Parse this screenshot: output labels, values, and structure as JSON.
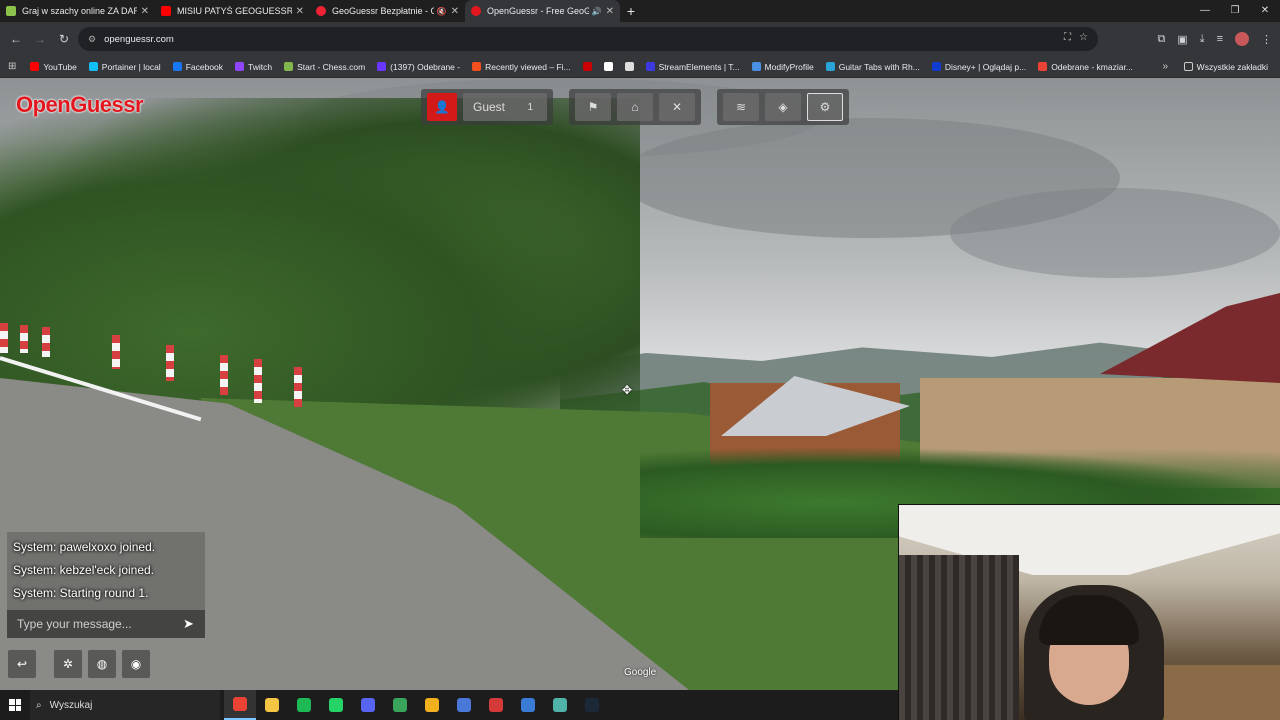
{
  "browser": {
    "tabs": [
      {
        "title": "Graj w szachy online ZA DARMO",
        "favicon_color": "#8bc34a",
        "active": false
      },
      {
        "title": "MISIU PATYŚ GEOGUESSR - You",
        "favicon_color": "#ff0000",
        "active": false
      },
      {
        "title": "GeoGuessr Bezpłatnie - Ge",
        "favicon_color": "#e23",
        "active": false
      },
      {
        "title": "OpenGuessr - Free GeoGue",
        "favicon_color": "#e4171f",
        "active": true
      }
    ],
    "new_tab_icon": "plus-icon",
    "url": "openguessr.com",
    "bookmarks": [
      {
        "label": "YouTube",
        "color": "#ff0000"
      },
      {
        "label": "Portainer | local",
        "color": "#13bef9"
      },
      {
        "label": "Facebook",
        "color": "#1877f2"
      },
      {
        "label": "Twitch",
        "color": "#9146ff"
      },
      {
        "label": "Start - Chess.com",
        "color": "#81b64c"
      },
      {
        "label": "(1397) Odebrane -",
        "color": "#6a35ff"
      },
      {
        "label": "Recently viewed – Fi...",
        "color": "#f24e1e"
      },
      {
        "label": "",
        "color": "#cc0000"
      },
      {
        "label": "",
        "color": "#ffffff"
      },
      {
        "label": "",
        "color": "#dddddd"
      },
      {
        "label": "StreamElements | T...",
        "color": "#3a3ae0"
      },
      {
        "label": "ModifyProfile",
        "color": "#4a90e2"
      },
      {
        "label": "Guitar Tabs with Rh...",
        "color": "#2aa4d8"
      },
      {
        "label": "Disney+ | Oglądaj p...",
        "color": "#113ccf"
      },
      {
        "label": "Odebrane - kmaziar...",
        "color": "#ea4335"
      }
    ],
    "all_bookmarks": "Wszystkie zakładki"
  },
  "game": {
    "brand": "OpenGuessr",
    "player_name": "Guest",
    "player_count": "1",
    "attribution": "Google",
    "chat": {
      "messages": [
        "System: pawelxoxo joined.",
        "System: kebzel'eck joined.",
        "System: Starting round 1."
      ],
      "placeholder": "Type your message..."
    }
  },
  "taskbar": {
    "search_label": "Wyszukaj",
    "apps": [
      {
        "name": "chrome",
        "color": "#ea4335",
        "active": true
      },
      {
        "name": "explorer",
        "color": "#f4c542",
        "active": false
      },
      {
        "name": "spotify",
        "color": "#1db954",
        "active": false
      },
      {
        "name": "whatsapp",
        "color": "#25d366",
        "active": false
      },
      {
        "name": "discord",
        "color": "#5865f2",
        "active": false
      },
      {
        "name": "app-green",
        "color": "#3aa65c",
        "active": false
      },
      {
        "name": "app-yellow",
        "color": "#f2b01e",
        "active": false
      },
      {
        "name": "app-blue",
        "color": "#4a78d9",
        "active": false
      },
      {
        "name": "app-red",
        "color": "#d43a3a",
        "active": false
      },
      {
        "name": "app-download",
        "color": "#3a7bd5",
        "active": false
      },
      {
        "name": "app-teal",
        "color": "#4fb3a9",
        "active": false
      },
      {
        "name": "steam",
        "color": "#1b2838",
        "active": false
      }
    ]
  }
}
